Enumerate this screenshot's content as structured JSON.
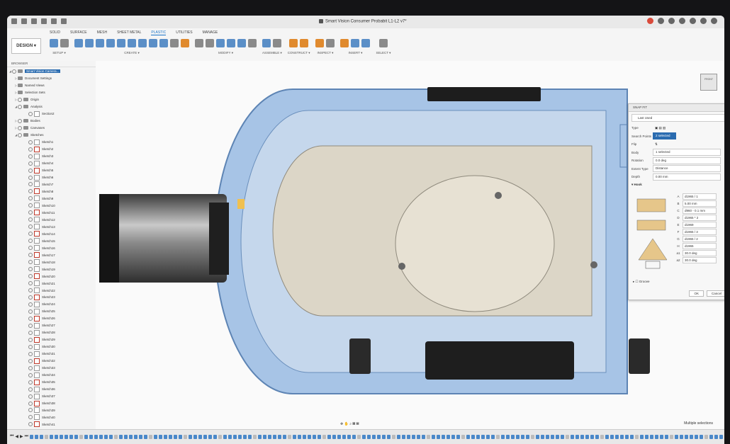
{
  "window": {
    "title": "Smart Vision Consumer Probabit L1-L2 v7*"
  },
  "ribbon": {
    "workspace": "DESIGN ▾",
    "tabs": [
      "SOLID",
      "SURFACE",
      "MESH",
      "SHEET METAL",
      "PLASTIC",
      "UTILITIES",
      "MANAGE"
    ],
    "active_tab": "PLASTIC",
    "groups": [
      "SETUP ▾",
      "CREATE ▾",
      "MODIFY ▾",
      "ASSEMBLE ▾",
      "CONSTRUCT ▾",
      "INSPECT ▾",
      "INSERT ▾",
      "SELECT ▾"
    ]
  },
  "browser": {
    "header": "BROWSER",
    "root": "Smart Vision Camera...",
    "items": [
      "Document Settings",
      "Named Views",
      "Selection Sets",
      "Origin",
      "Analysis",
      "Section2",
      "Bodies",
      "Canvases",
      "Sketches"
    ],
    "sketches": [
      "Sketch1",
      "Sketch2",
      "Sketch3",
      "Sketch4",
      "Sketch5",
      "Sketch6",
      "Sketch7",
      "Sketch8",
      "Sketch9",
      "Sketch10",
      "Sketch11",
      "Sketch12",
      "Sketch13",
      "Sketch14",
      "Sketch15",
      "Sketch16",
      "Sketch17",
      "Sketch18",
      "Sketch19",
      "Sketch20",
      "Sketch21",
      "Sketch22",
      "Sketch23",
      "Sketch24",
      "Sketch25",
      "Sketch26",
      "Sketch27",
      "Sketch28",
      "Sketch29",
      "Sketch30",
      "Sketch31",
      "Sketch32",
      "Sketch33",
      "Sketch34",
      "Sketch35",
      "Sketch36",
      "Sketch37",
      "Sketch38",
      "Sketch39",
      "Sketch40",
      "Sketch41"
    ]
  },
  "panel": {
    "title": "SNAP FIT",
    "preset": "Last Used",
    "fields": [
      {
        "k": "Type",
        "v": ""
      },
      {
        "k": "Search Points",
        "v": "2 selected"
      },
      {
        "k": "Flip",
        "v": ""
      },
      {
        "k": "Body",
        "v": "1 selected"
      },
      {
        "k": "Rotation",
        "v": "0.0 deg"
      },
      {
        "k": "Extent Type",
        "v": "Distance"
      },
      {
        "k": "Depth",
        "v": "0.00 mm"
      }
    ],
    "hook_label": "Hook",
    "dims": [
      {
        "k": "A",
        "v": "d1965 / 1"
      },
      {
        "k": "B",
        "v": "5.00 mm"
      },
      {
        "k": "C",
        "v": "d960 - 0.1 mm"
      },
      {
        "k": "D",
        "v": "d1965 * 2"
      },
      {
        "k": "E",
        "v": "d1969"
      },
      {
        "k": "F",
        "v": "d1965 / 3"
      },
      {
        "k": "G",
        "v": "d1965 / 2"
      },
      {
        "k": "H",
        "v": "d1965"
      },
      {
        "k": "a1",
        "v": "30.0 deg"
      },
      {
        "k": "a2",
        "v": "30.0 deg"
      }
    ],
    "groove_label": "Groove",
    "ok": "OK",
    "cancel": "Cancel"
  },
  "viewcube": {
    "label": "FRONT"
  },
  "status": {
    "multi": "Multiple selections"
  },
  "colors": {
    "accent": "#1a73c9",
    "shell": "#9fc0e6",
    "body": "#d8d3c6"
  }
}
